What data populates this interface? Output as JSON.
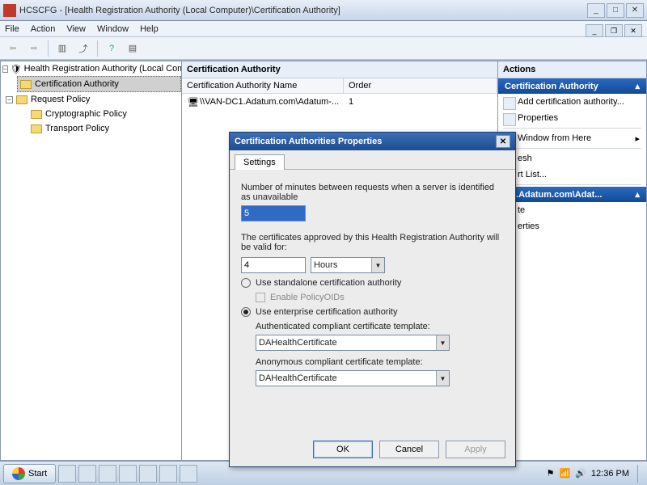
{
  "window": {
    "title": "HCSCFG - [Health Registration Authority (Local Computer)\\Certification Authority]"
  },
  "menu": {
    "items": [
      "File",
      "Action",
      "View",
      "Window",
      "Help"
    ]
  },
  "tree": {
    "root": "Health Registration Authority (Local Comp",
    "cert_auth": "Certification Authority",
    "request_policy": "Request Policy",
    "crypto_policy": "Cryptographic Policy",
    "transport_policy": "Transport Policy"
  },
  "list": {
    "heading": "Certification Authority",
    "col1": "Certification Authority Name",
    "col2": "Order",
    "row1_name": "\\\\VAN-DC1.Adatum.com\\Adatum-...",
    "row1_order": "1"
  },
  "actions": {
    "heading": "Actions",
    "section1": "Certification Authority",
    "items1": [
      "Add certification authority...",
      "Properties"
    ],
    "new_window": "Window from Here",
    "refresh": "esh",
    "export": "rt List...",
    "section2": "C1.Adatum.com\\Adat...",
    "items2": [
      "te",
      "erties"
    ]
  },
  "dialog": {
    "title": "Certification Authorities Properties",
    "tab": "Settings",
    "minutes_label": "Number of minutes between requests when a server is identified as unavailable",
    "minutes_value": "5",
    "valid_label": "The certificates approved by this Health Registration Authority will be valid for:",
    "valid_value": "4",
    "valid_unit": "Hours",
    "radio_standalone": "Use standalone certification authority",
    "chk_policyoids": "Enable PolicyOIDs",
    "radio_enterprise": "Use enterprise certification authority",
    "auth_template_label": "Authenticated compliant certificate template:",
    "auth_template_value": "DAHealthCertificate",
    "anon_template_label": "Anonymous compliant certificate template:",
    "anon_template_value": "DAHealthCertificate",
    "ok": "OK",
    "cancel": "Cancel",
    "apply": "Apply"
  },
  "taskbar": {
    "start": "Start",
    "time": "12:36 PM"
  }
}
